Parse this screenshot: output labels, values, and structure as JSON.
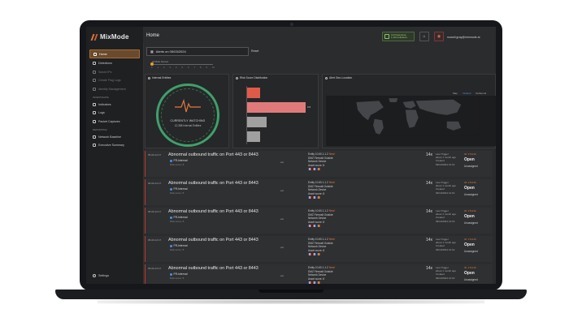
{
  "app": {
    "logo": "MixMode",
    "page_title": "Home"
  },
  "sidebar": {
    "items": [
      {
        "label": "Home",
        "icon": "home-icon",
        "active": true,
        "dim": false
      },
      {
        "label": "Detections",
        "icon": "grid-icon",
        "active": false,
        "dim": false
      },
      {
        "label": "Saved IPs",
        "icon": "bookmark-icon",
        "active": false,
        "dim": true
      },
      {
        "label": "Create Flag Logs",
        "icon": "flag-icon",
        "active": false,
        "dim": true
      },
      {
        "label": "Identity Management",
        "icon": "id-icon",
        "active": false,
        "dim": true
      }
    ],
    "section1": "INVESTIGATE",
    "items2": [
      {
        "label": "Indicators",
        "icon": "target-icon"
      },
      {
        "label": "Logs",
        "icon": "log-icon"
      },
      {
        "label": "Packet Captures",
        "icon": "packet-icon"
      }
    ],
    "section2": "REPORTING",
    "items3": [
      {
        "label": "Network Baseline",
        "icon": "chart-line-icon"
      },
      {
        "label": "Executive Summary",
        "icon": "summary-icon"
      }
    ],
    "settings": "Settings"
  },
  "header": {
    "notification_line1": "123 Detections",
    "notification_line2": "1,234 Indicators",
    "user_email": "russell.gray@mixmode.ai"
  },
  "filters": {
    "date": "Alerts on 05/03/2024",
    "reset": "Reset",
    "risk_label": "All Risk Scores",
    "risk_ticks": [
      "0",
      "1",
      "2",
      "3",
      "4",
      "5",
      "6",
      "7",
      "8",
      "9",
      "10"
    ]
  },
  "panels": {
    "internal": {
      "title": "Internal Entities",
      "watching": "CURRENTLY WATCHING",
      "count": "12,358 Internal Entities"
    },
    "risk": {
      "title": "Risk Score Distribution"
    },
    "geo": {
      "title": "Alert Geo-Location",
      "links": [
        "Map",
        "Incident",
        "Outbound"
      ]
    }
  },
  "chart_data": {
    "type": "bar",
    "title": "Risk Score Distribution",
    "categories": [
      "",
      "",
      "",
      ""
    ],
    "values": [
      2,
      9,
      3,
      2
    ],
    "value_labels": [
      "",
      "9.8",
      "",
      ""
    ],
    "colors": [
      "#e05a4a",
      "#e07a7a",
      "#a0a0a0",
      "#a0a0a0"
    ],
    "xlim": [
      0,
      10
    ]
  },
  "rows": [
    {
      "time": "05-03-12:17",
      "title": "Abnormal outbound traffic on Port 443 or 8443",
      "tag": "FR-Internal",
      "sub": "Risk score: 8",
      "ext": "ext",
      "entity_line1": "Entity 10.60.1.1.2",
      "entity_new": "New!",
      "entity_line2": "DMZ Firewall Outside",
      "entity_line3": "Network Device",
      "entity_line4": "Asset score: 8",
      "count": "14x",
      "trig1": "Last Trigger",
      "trig2": "about 1 month ago",
      "trig3": "Created",
      "trig4": "09/13/2024 12:19",
      "id": "ID: 171216",
      "status": "Open",
      "assign": "Unassigned"
    },
    {
      "time": "05-03-12:17",
      "title": "Abnormal outbound traffic on Port 443 or 8443",
      "tag": "FR-Internal",
      "sub": "Risk score: 8",
      "ext": "ext",
      "entity_line1": "Entity 10.60.1.1.2",
      "entity_new": "New!",
      "entity_line2": "DMZ Firewall Outside",
      "entity_line3": "Network Device",
      "entity_line4": "Asset score: 8",
      "count": "14x",
      "trig1": "Last Trigger",
      "trig2": "about 1 month ago",
      "trig3": "Created",
      "trig4": "09/13/2024 12:19",
      "id": "ID: 171216",
      "status": "Open",
      "assign": "Unassigned"
    },
    {
      "time": "05-03-12:17",
      "title": "Abnormal outbound traffic on Port 443 or 8443",
      "tag": "FR-Internal",
      "sub": "Risk score: 8",
      "ext": "ext",
      "entity_line1": "Entity 10.60.1.1.2",
      "entity_new": "New!",
      "entity_line2": "DMZ Firewall Outside",
      "entity_line3": "Network Device",
      "entity_line4": "Asset score: 8",
      "count": "14x",
      "trig1": "Last Trigger",
      "trig2": "about 1 month ago",
      "trig3": "Created",
      "trig4": "09/13/2024 12:19",
      "id": "ID: 171216",
      "status": "Open",
      "assign": "Unassigned"
    },
    {
      "time": "05-03-12:17",
      "title": "Abnormal outbound traffic on Port 443 or 8443",
      "tag": "FR-Internal",
      "sub": "Risk score: 8",
      "ext": "ext",
      "entity_line1": "Entity 10.60.1.1.2",
      "entity_new": "New!",
      "entity_line2": "DMZ Firewall Outside",
      "entity_line3": "Network Device",
      "entity_line4": "Asset score: 8",
      "count": "14x",
      "trig1": "Last Trigger",
      "trig2": "about 1 month ago",
      "trig3": "Created",
      "trig4": "09/13/2024 12:19",
      "id": "ID: 171216",
      "status": "Open",
      "assign": "Unassigned"
    },
    {
      "time": "05-03-12:17",
      "title": "Abnormal outbound traffic on Port 443 or 8443",
      "tag": "FR-Internal",
      "sub": "Risk score: 8",
      "ext": "ext",
      "entity_line1": "Entity 10.60.1.1.2",
      "entity_new": "New!",
      "entity_line2": "DMZ Firewall Outside",
      "entity_line3": "Network Device",
      "entity_line4": "Asset score: 8",
      "count": "14x",
      "trig1": "Last Trigger",
      "trig2": "about 1 month ago",
      "trig3": "Created",
      "trig4": "09/13/2024 12:19",
      "id": "ID: 171216",
      "status": "Open",
      "assign": "Unassigned"
    }
  ],
  "colors": {
    "accent": "#e07a3a",
    "alert": "#c0392b",
    "ok": "#3fa06a"
  }
}
